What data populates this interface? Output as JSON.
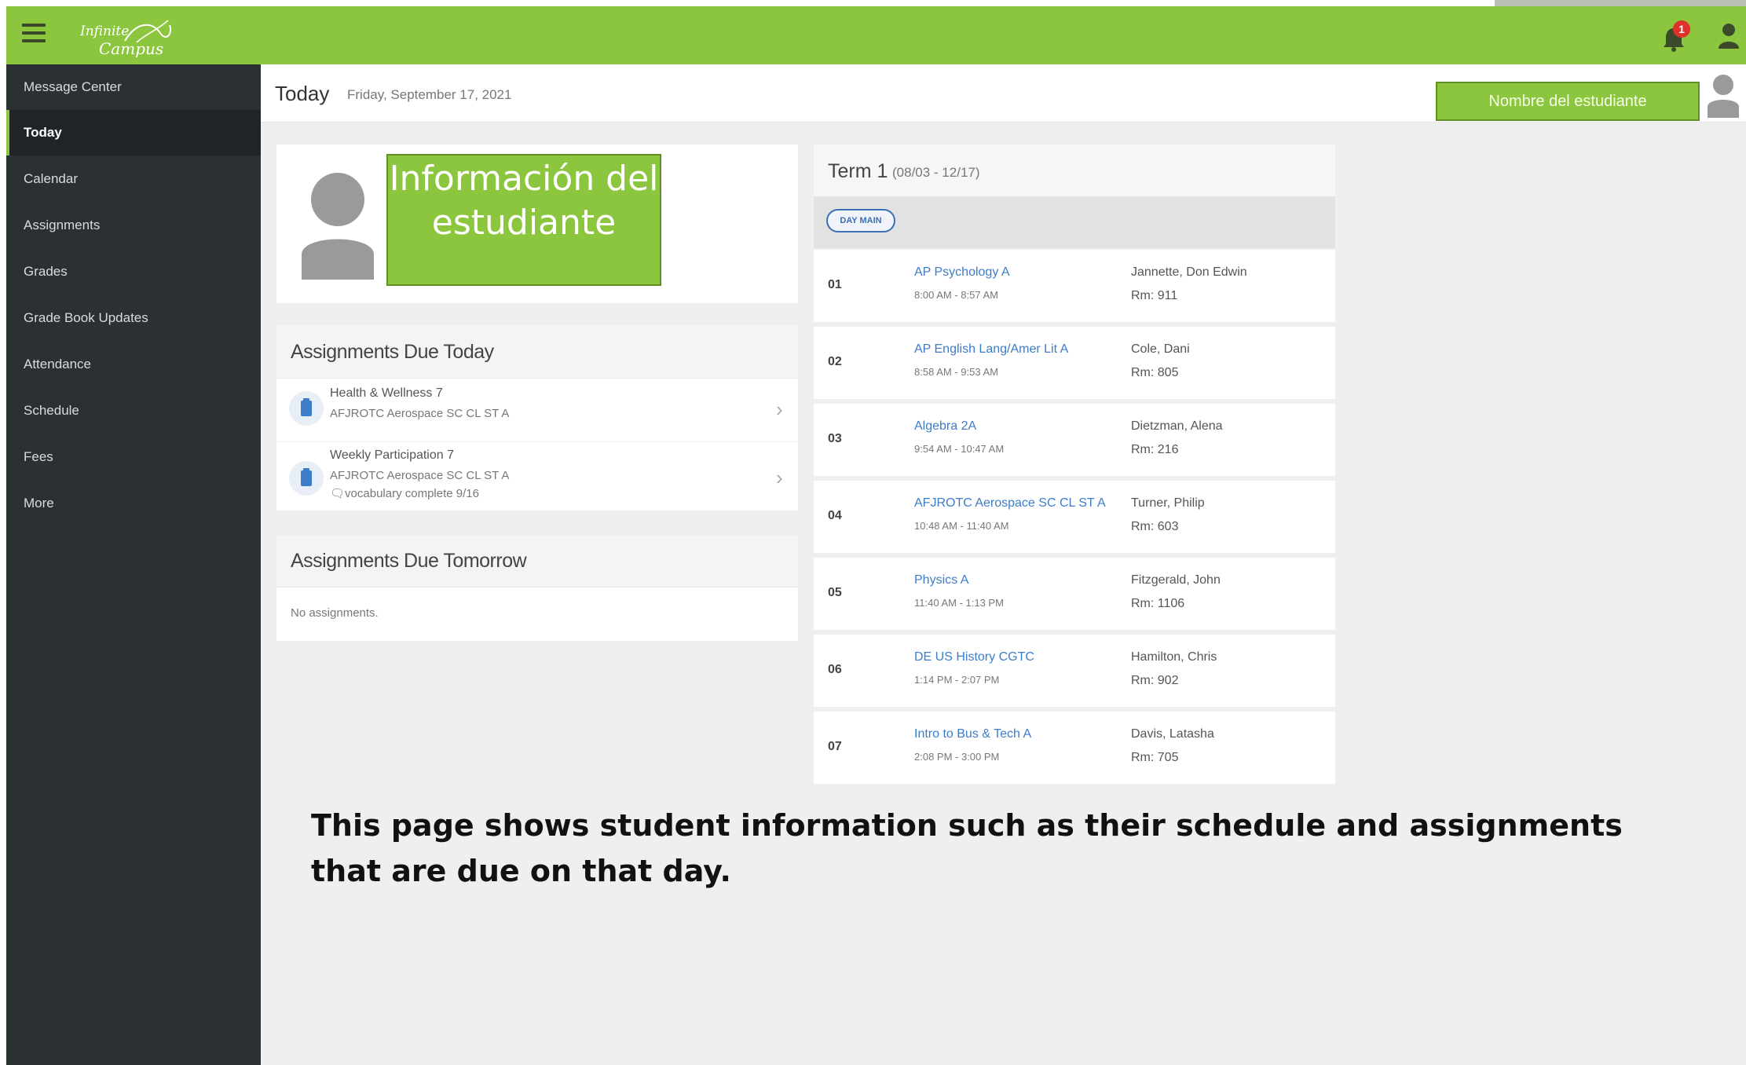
{
  "app": {
    "logo_top": "Infinite",
    "logo_bottom": "Campus",
    "notification_count": "1"
  },
  "sidebar": {
    "items": [
      {
        "label": "Message Center"
      },
      {
        "label": "Today"
      },
      {
        "label": "Calendar"
      },
      {
        "label": "Assignments"
      },
      {
        "label": "Grades"
      },
      {
        "label": "Grade Book Updates"
      },
      {
        "label": "Attendance"
      },
      {
        "label": "Schedule"
      },
      {
        "label": "Fees"
      },
      {
        "label": "More"
      }
    ],
    "active": "Today"
  },
  "header": {
    "title": "Today",
    "date": "Friday, September 17, 2021",
    "student_name": "Nombre del estudiante"
  },
  "profile": {
    "info_text": "Información del estudiante"
  },
  "due_today": {
    "title": "Assignments Due Today",
    "items": [
      {
        "name": "Health & Wellness 7",
        "course": "AFJROTC Aerospace SC CL ST A",
        "note": ""
      },
      {
        "name": "Weekly Participation 7",
        "course": "AFJROTC Aerospace SC CL ST A",
        "note": "vocabulary complete 9/16"
      }
    ]
  },
  "due_tomorrow": {
    "title": "Assignments Due Tomorrow",
    "empty": "No assignments."
  },
  "term": {
    "title": "Term 1",
    "range": "(08/03 - 12/17)",
    "day": "DAY MAIN",
    "periods": [
      {
        "num": "01",
        "course": "AP Psychology A",
        "time": "8:00 AM - 8:57 AM",
        "teacher": "Jannette, Don Edwin",
        "room": "Rm: 911"
      },
      {
        "num": "02",
        "course": "AP English Lang/Amer Lit A",
        "time": "8:58 AM - 9:53 AM",
        "teacher": "Cole, Dani",
        "room": "Rm: 805"
      },
      {
        "num": "03",
        "course": "Algebra 2A",
        "time": "9:54 AM - 10:47 AM",
        "teacher": "Dietzman, Alena",
        "room": "Rm: 216"
      },
      {
        "num": "04",
        "course": "AFJROTC Aerospace SC CL ST A",
        "time": "10:48 AM - 11:40 AM",
        "teacher": "Turner, Philip",
        "room": "Rm: 603"
      },
      {
        "num": "05",
        "course": "Physics A",
        "time": "11:40 AM - 1:13 PM",
        "teacher": "Fitzgerald, John",
        "room": "Rm: 1106"
      },
      {
        "num": "06",
        "course": "DE US History CGTC",
        "time": "1:14 PM - 2:07 PM",
        "teacher": "Hamilton, Chris",
        "room": "Rm: 902"
      },
      {
        "num": "07",
        "course": "Intro to Bus & Tech A",
        "time": "2:08 PM - 3:00 PM",
        "teacher": "Davis, Latasha",
        "room": "Rm: 705"
      }
    ]
  },
  "caption": "This page shows student information such as their schedule and assignments that are due on that day.",
  "colors": {
    "brand": "#8cc63f",
    "sidebar": "#2b3033",
    "link": "#3d7cc9"
  }
}
